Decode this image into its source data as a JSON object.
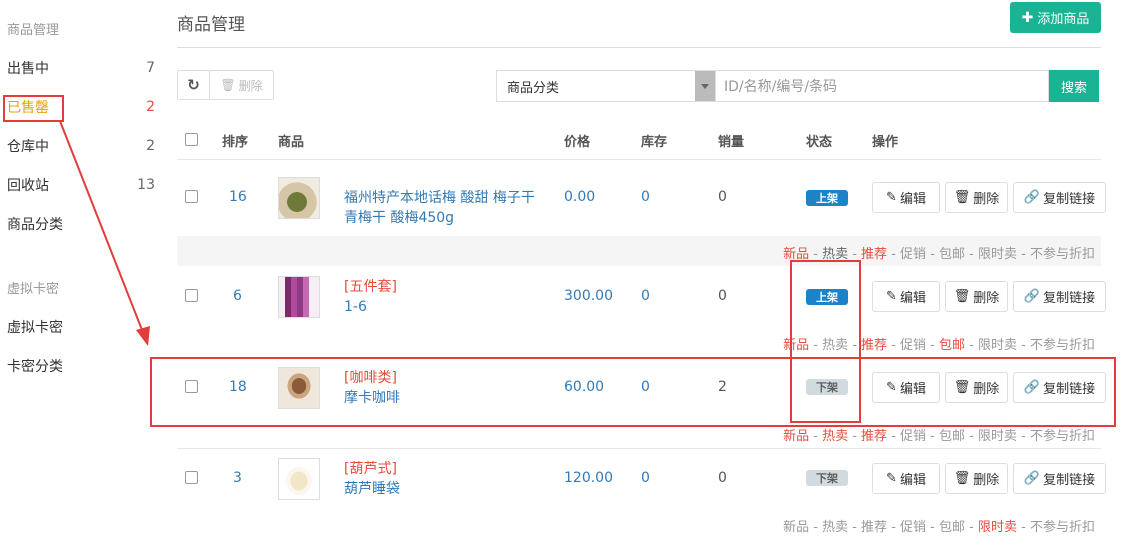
{
  "sidebar": {
    "group1": "商品管理",
    "items": [
      {
        "label": "出售中",
        "count": "7"
      },
      {
        "label": "已售罄",
        "count": "2"
      },
      {
        "label": "仓库中",
        "count": "2"
      },
      {
        "label": "回收站",
        "count": "13"
      },
      {
        "label": "商品分类",
        "count": ""
      }
    ],
    "group2": "虚拟卡密",
    "items2": [
      {
        "label": "虚拟卡密"
      },
      {
        "label": "卡密分类"
      }
    ]
  },
  "header": {
    "title": "商品管理",
    "add_button": "添加商品"
  },
  "toolbar": {
    "delete": "删除",
    "category": "商品分类",
    "search_placeholder": "ID/名称/编号/条码",
    "search": "搜索"
  },
  "table": {
    "columns": {
      "sort": "排序",
      "product": "商品",
      "price": "价格",
      "stock": "库存",
      "sales": "销量",
      "status": "状态",
      "ops": "操作"
    },
    "rows": [
      {
        "sort": "16",
        "tag": "",
        "name": "福州特产本地话梅 酸甜 梅子干青梅干 酸梅450g",
        "price": "0.00",
        "stock": "0",
        "sales": "0",
        "status": "上架"
      },
      {
        "sort": "6",
        "tag": "[五件套]",
        "name": "1-6",
        "price": "300.00",
        "stock": "0",
        "sales": "0",
        "status": "上架"
      },
      {
        "sort": "18",
        "tag": "[咖啡类]",
        "name": "摩卡咖啡",
        "price": "60.00",
        "stock": "0",
        "sales": "2",
        "status": "下架"
      },
      {
        "sort": "3",
        "tag": "[葫芦式]",
        "name": "葫芦睡袋",
        "price": "120.00",
        "stock": "0",
        "sales": "0",
        "status": "下架"
      }
    ],
    "ops": {
      "edit": "编辑",
      "delete": "删除",
      "copy": "复制链接"
    },
    "tags": [
      "新品",
      "热卖",
      "推荐",
      "促销",
      "包邮",
      "限时卖",
      "不参与折扣"
    ]
  },
  "colors": {
    "accent": "#1ab394",
    "primary": "#1c84c6",
    "annotation": "#e43b3b"
  }
}
